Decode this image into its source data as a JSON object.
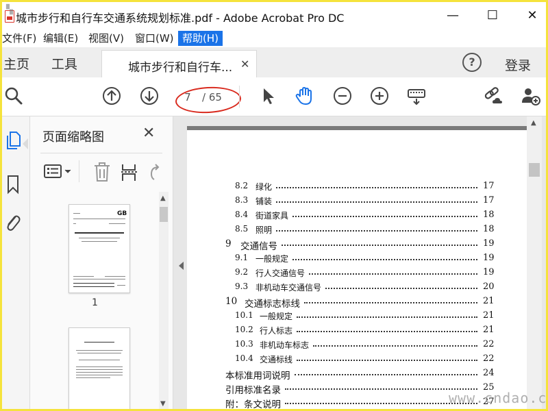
{
  "window": {
    "title": "城市步行和自行车交通系统规划标准.pdf - Adobe Acrobat Pro DC",
    "minimize_glyph": "—",
    "maximize_glyph": "☐",
    "close_glyph": "✕"
  },
  "menu": {
    "items": [
      "文件(F)",
      "编辑(E)",
      "视图(V)",
      "窗口(W)",
      "帮助(H)"
    ],
    "active": "帮助(H)"
  },
  "tabs": {
    "home": "主页",
    "tools": "工具",
    "document": "城市步行和自行车...",
    "close_glyph": "✕",
    "help_glyph": "?",
    "login": "登录"
  },
  "toolbar": {
    "current_page": "7",
    "total_pages": "/ 65"
  },
  "thumbnail_panel": {
    "title": "页面缩略图",
    "close_glyph": "✕",
    "thumbnails": [
      {
        "label": "1",
        "logo": "GB"
      },
      {
        "label": ""
      }
    ]
  },
  "toc": [
    {
      "num": "8.2",
      "title": "绿化",
      "page": "17",
      "level": 2
    },
    {
      "num": "8.3",
      "title": "铺装",
      "page": "17",
      "level": 2
    },
    {
      "num": "8.4",
      "title": "街道家具",
      "page": "18",
      "level": 2
    },
    {
      "num": "8.5",
      "title": "照明",
      "page": "18",
      "level": 2
    },
    {
      "num": "9",
      "title": "交通信号",
      "page": "19",
      "level": 1
    },
    {
      "num": "9.1",
      "title": "一般规定",
      "page": "19",
      "level": 2
    },
    {
      "num": "9.2",
      "title": "行人交通信号",
      "page": "19",
      "level": 2
    },
    {
      "num": "9.3",
      "title": "非机动车交通信号",
      "page": "20",
      "level": 2
    },
    {
      "num": "10",
      "title": "交通标志标线",
      "page": "21",
      "level": 1
    },
    {
      "num": "10.1",
      "title": "一般规定",
      "page": "21",
      "level": 2
    },
    {
      "num": "10.2",
      "title": "行人标志",
      "page": "21",
      "level": 2
    },
    {
      "num": "10.3",
      "title": "非机动车标志",
      "page": "22",
      "level": 2
    },
    {
      "num": "10.4",
      "title": "交通标线",
      "page": "22",
      "level": 2
    },
    {
      "num": "",
      "title": "本标准用词说明",
      "page": "24",
      "level": 0
    },
    {
      "num": "",
      "title": "引用标准名录",
      "page": "25",
      "level": 0
    },
    {
      "num": "",
      "title": "附：条文说明",
      "page": "27",
      "level": 0
    }
  ],
  "watermark": "www.cndao.com",
  "colors": {
    "accent": "#1a73e8",
    "annotation": "#d92a1e",
    "hand_tool": "#1a73e8",
    "frame": "#f5e33c"
  },
  "icons": {
    "search": "magnifier",
    "prev_page": "arrow-up-circle",
    "next_page": "arrow-down-circle",
    "select": "cursor-arrow",
    "hand": "hand",
    "zoom_out": "minus-circle",
    "zoom_in": "plus-circle",
    "keyboard": "keyboard",
    "share_link": "link-cloud",
    "add_user": "person-plus"
  }
}
